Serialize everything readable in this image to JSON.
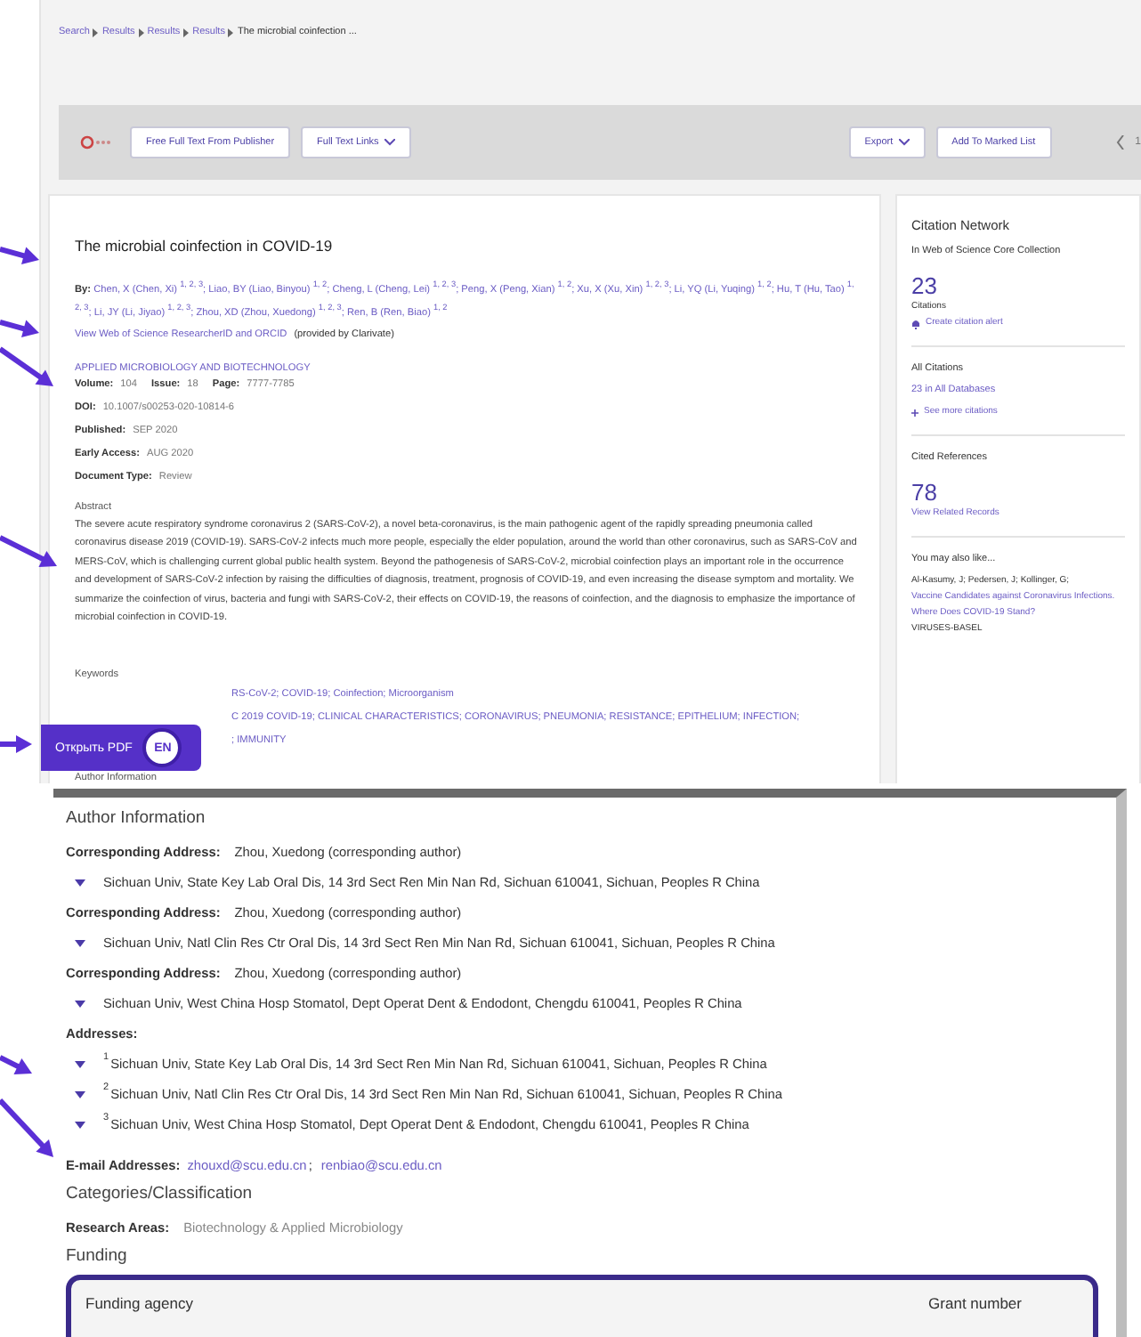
{
  "breadcrumb": [
    "Search",
    "Results",
    "Results",
    "Results",
    "The microbial coinfection ..."
  ],
  "toolbar": {
    "buttons": [
      {
        "label": "Free Full Text From Publisher",
        "dropdown": false
      },
      {
        "label": "Full Text Links",
        "dropdown": true
      },
      {
        "label": "Export",
        "dropdown": true
      },
      {
        "label": "Add To Marked List",
        "dropdown": false
      }
    ],
    "page": "1"
  },
  "record": {
    "title": "The microbial coinfection in COVID-19",
    "authors_label": "By:",
    "authors": "Chen, X (Chen, Xi) $^{1, 2, 3}$; Liao, BY (Liao, Binyou) $^{1, 2}$; Cheng, L (Cheng, Lei) $^{1, 2, 3}$; Peng, X (Peng, Xian) $^{1, 2}$; Xu, X (Xu, Xin) $^{1, 2, 3}$; Li, YQ (Li, Yuqing) $^{1, 2}$; Hu, T (Hu, Tao) $^{1, 2, 3}$; Li, JY (Li, Jiyao) $^{1, 2, 3}$; Zhou, XD (Zhou, Xuedong) $^{1, 2, 3}$; Ren, B (Ren, Biao) $^{1, 2}$",
    "researcher_link": "View Web of Science ResearcherID and ORCID",
    "researcher_note": "(provided by Clarivate)",
    "journal": "APPLIED MICROBIOLOGY AND BIOTECHNOLOGY",
    "volume_fields": [
      {
        "label": "Volume:",
        "value": "104"
      },
      {
        "label": "Issue:",
        "value": "18"
      },
      {
        "label": "Page:",
        "value": "7777-7785"
      }
    ],
    "fields": [
      {
        "label": "DOI:",
        "value": "10.1007/s00253-020-10814-6"
      },
      {
        "label": "Published:",
        "value": "SEP 2020"
      },
      {
        "label": "Early Access:",
        "value": "AUG 2020"
      },
      {
        "label": "Document Type:",
        "value": "Review"
      }
    ],
    "abstract_label": "Abstract",
    "abstract": "The severe acute respiratory syndrome coronavirus 2 (SARS-CoV-2), a novel beta-coronavirus, is the main pathogenic agent of the rapidly spreading pneumonia called coronavirus disease 2019 (COVID-19). SARS-CoV-2 infects much more people, especially the elder population, around the world than other coronavirus, such as SARS-CoV and MERS-CoV, which is challenging current global public health system. Beyond the pathogenesis of SARS-CoV-2, microbial coinfection plays an important role in the occurrence and development of SARS-CoV-2 infection by raising the difficulties of diagnosis, treatment, prognosis of COVID-19, and even increasing the disease symptom and mortality. We summarize the coinfection of virus, bacteria and fungi with SARS-CoV-2, their effects on COVID-19, the reasons of coinfection, and the diagnosis to emphasize the importance of microbial coinfection in COVID-19.",
    "keywords_label": "Keywords",
    "keywords": [
      "RS-CoV-2; COVID-19; Coinfection; Microorganism",
      "C 2019 COVID-19; CLINICAL CHARACTERISTICS; CORONAVIRUS; PNEUMONIA; RESISTANCE; EPITHELIUM; INFECTION;",
      "; IMMUNITY"
    ],
    "author_info_label": "Author Information"
  },
  "pdf_button": {
    "label": "Открыть PDF",
    "lang": "EN"
  },
  "citation_network": {
    "title": "Citation Network",
    "subtitle": "In Web of Science Core Collection",
    "citations": "23",
    "citations_label": "Citations",
    "alert_link": "Create citation alert",
    "all_citations_label": "All Citations",
    "all_citations_link": "23 in All Databases",
    "see_more": "See more citations",
    "cited_references_label": "Cited References",
    "cited_references": "78",
    "related_link": "View Related Records",
    "also_like_label": "You may also like...",
    "also_like_authors": "Al-Kasumy, J; Pedersen, J; Kollinger, G;",
    "also_like_title": "Vaccine Candidates against Coronavirus Infections. Where Does COVID-19 Stand?",
    "also_like_journal": "VIRUSES-BASEL"
  },
  "detail": {
    "heading": "Author Information",
    "corresponding": [
      {
        "label": "Corresponding Address:",
        "name": "Zhou, Xuedong (corresponding author)",
        "address": "Sichuan Univ, State Key Lab Oral Dis, 14 3rd Sect Ren Min Nan Rd, Sichuan 610041, Sichuan, Peoples R China"
      },
      {
        "label": "Corresponding Address:",
        "name": "Zhou, Xuedong (corresponding author)",
        "address": "Sichuan Univ, Natl Clin Res Ctr Oral Dis, 14 3rd Sect Ren Min Nan Rd, Sichuan 610041, Sichuan, Peoples R China"
      },
      {
        "label": "Corresponding Address:",
        "name": "Zhou, Xuedong (corresponding author)",
        "address": "Sichuan Univ, West China Hosp Stomatol, Dept Operat Dent & Endodont, Chengdu 610041, Peoples R China"
      }
    ],
    "addresses_label": "Addresses:",
    "addresses": [
      {
        "index": "1",
        "text": "Sichuan Univ, State Key Lab Oral Dis, 14 3rd Sect Ren Min Nan Rd, Sichuan 610041, Sichuan, Peoples R China"
      },
      {
        "index": "2",
        "text": "Sichuan Univ, Natl Clin Res Ctr Oral Dis, 14 3rd Sect Ren Min Nan Rd, Sichuan 610041, Sichuan, Peoples R China"
      },
      {
        "index": "3",
        "text": "Sichuan Univ, West China Hosp Stomatol, Dept Operat Dent & Endodont, Chengdu 610041, Peoples R China"
      }
    ],
    "email_label": "E-mail Addresses:",
    "emails": [
      "zhouxd@scu.edu.cn",
      "renbiao@scu.edu.cn"
    ],
    "email_separator": ";",
    "categories_heading": "Categories/Classification",
    "research_areas_label": "Research Areas:",
    "research_areas": "Biotechnology & Applied Microbiology",
    "funding_heading": "Funding",
    "funding_columns": [
      "Funding agency",
      "Grant number"
    ]
  }
}
